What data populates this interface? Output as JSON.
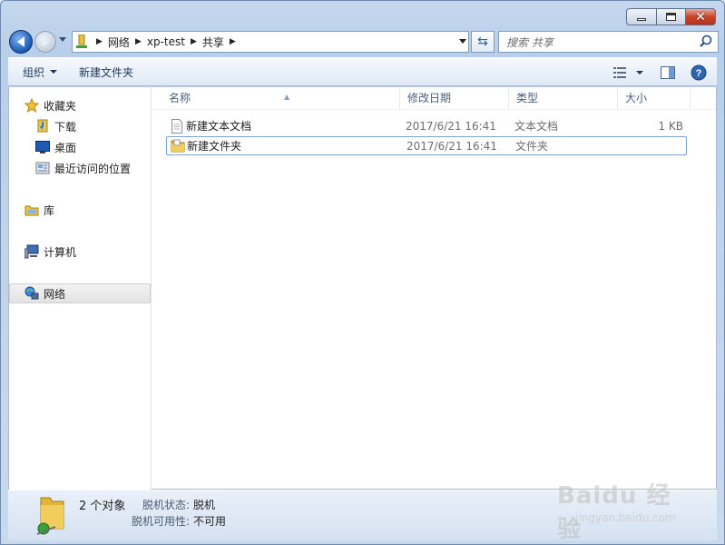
{
  "navigation": {
    "breadcrumbs": [
      "网络",
      "xp-test",
      "共享"
    ]
  },
  "search": {
    "placeholder": "搜索 共享"
  },
  "toolbar": {
    "organize_label": "组织",
    "new_folder_label": "新建文件夹"
  },
  "sidebar": {
    "favorites_label": "收藏夹",
    "items": [
      {
        "label": "下载"
      },
      {
        "label": "桌面"
      },
      {
        "label": "最近访问的位置"
      }
    ],
    "libraries_label": "库",
    "computer_label": "计算机",
    "network_label": "网络"
  },
  "columns": {
    "name": "名称",
    "date": "修改日期",
    "type": "类型",
    "size": "大小"
  },
  "files": [
    {
      "name": "新建文本文档",
      "date": "2017/6/21 16:41",
      "type": "文本文档",
      "size": "1 KB",
      "icon": "text-file-icon"
    },
    {
      "name": "新建文件夹",
      "date": "2017/6/21 16:41",
      "type": "文件夹",
      "size": "",
      "icon": "folder-icon"
    }
  ],
  "details": {
    "count_text": "2 个对象",
    "offline_status_label": "脱机状态:",
    "offline_status_value": "脱机",
    "offline_avail_label": "脱机可用性:",
    "offline_avail_value": "不可用"
  },
  "watermark": {
    "brand": "Baidu 经验",
    "url": "jingyan.baidu.com"
  }
}
